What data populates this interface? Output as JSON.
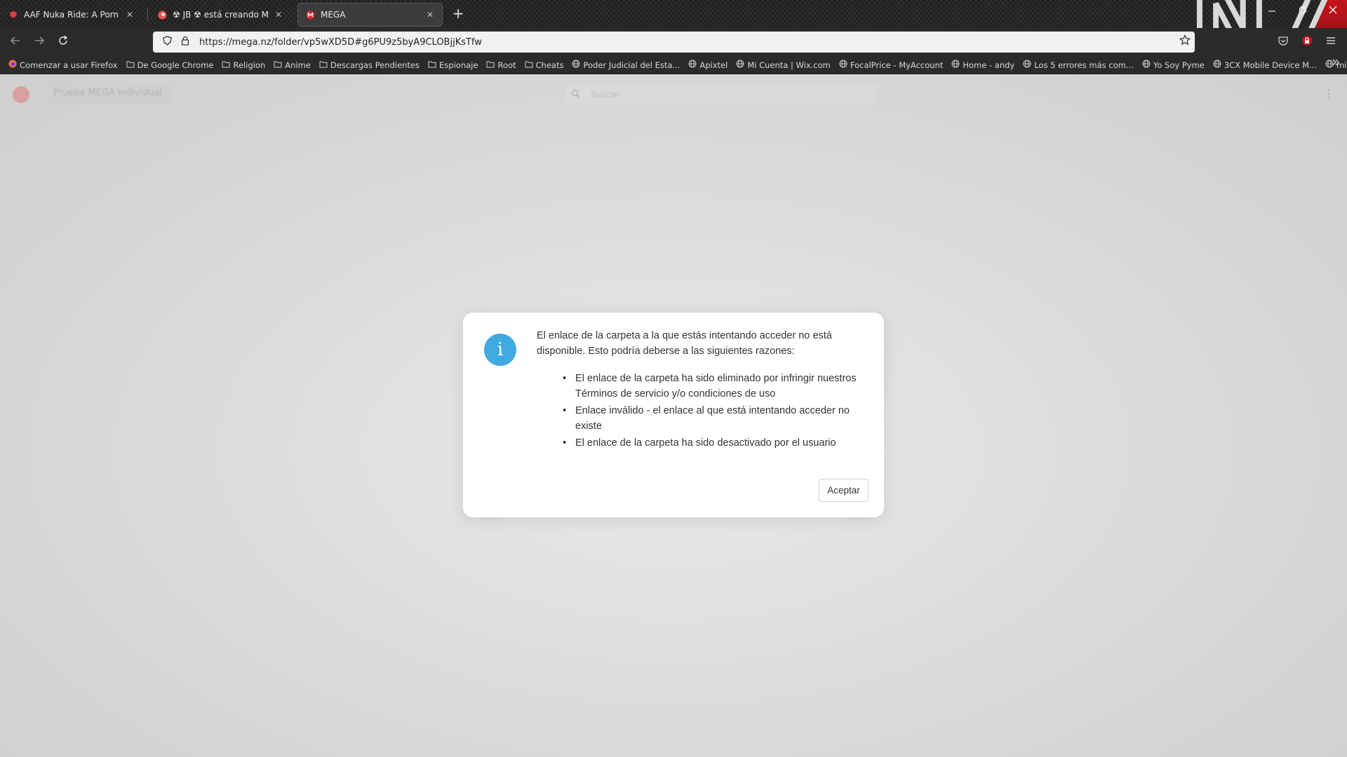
{
  "browser": {
    "tabs": [
      {
        "title": "AAF Nuka Ride: A Porn Studio M",
        "active": false
      },
      {
        "title": "☢ JB ☢ está creando Mods for F",
        "active": false
      },
      {
        "title": "MEGA",
        "active": true
      }
    ],
    "tab_close_glyph": "✕",
    "new_tab_glyph": "+",
    "url": "https://mega.nz/folder/vp5wXD5D#g6PU9z5byA9CLOBjjKsTfw",
    "bookmarks": [
      {
        "label": "Comenzar a usar Firefox",
        "icon": "firefox-icon"
      },
      {
        "label": "De Google Chrome",
        "icon": "folder-icon"
      },
      {
        "label": "Religion",
        "icon": "folder-icon"
      },
      {
        "label": "Anime",
        "icon": "folder-icon"
      },
      {
        "label": "Descargas Pendientes",
        "icon": "folder-icon"
      },
      {
        "label": "Espionaje",
        "icon": "folder-icon"
      },
      {
        "label": "Root",
        "icon": "folder-icon"
      },
      {
        "label": "Cheats",
        "icon": "folder-icon"
      },
      {
        "label": "Poder Judicial del Esta...",
        "icon": "globe-icon"
      },
      {
        "label": "Apixtel",
        "icon": "globe-icon"
      },
      {
        "label": "Mi Cuenta | Wix.com",
        "icon": "globe-icon"
      },
      {
        "label": "FocalPrice - MyAccount",
        "icon": "globe-icon"
      },
      {
        "label": "Home - andy",
        "icon": "globe-icon"
      },
      {
        "label": "Los 5 errores más com...",
        "icon": "globe-icon"
      },
      {
        "label": "Yo Soy Pyme",
        "icon": "globe-icon"
      },
      {
        "label": "3CX Mobile Device M...",
        "icon": "globe-icon"
      },
      {
        "label": "mini aplicaciones en E...",
        "icon": "globe-icon"
      }
    ],
    "theme_text": "N7",
    "colors": {
      "accent_red": "#c4161c",
      "chrome_dark": "#2b2b2b"
    }
  },
  "mega": {
    "promo_label": "Prueba MEGA individual",
    "search_placeholder": "Buscar",
    "dialog": {
      "message": "El enlace de la carpeta a la que estás intentando acceder no está disponible. Esto podría deberse a las siguientes razones:",
      "reasons": [
        "El enlace de la carpeta ha sido eliminado por infringir nuestros Términos de servicio y/o condiciones de uso",
        "Enlace inválido - el enlace al que está intentando acceder no existe",
        "El enlace de la carpeta ha sido desactivado por el usuario"
      ],
      "accept_label": "Aceptar",
      "info_glyph": "i",
      "info_color": "#3fa9e0"
    }
  }
}
